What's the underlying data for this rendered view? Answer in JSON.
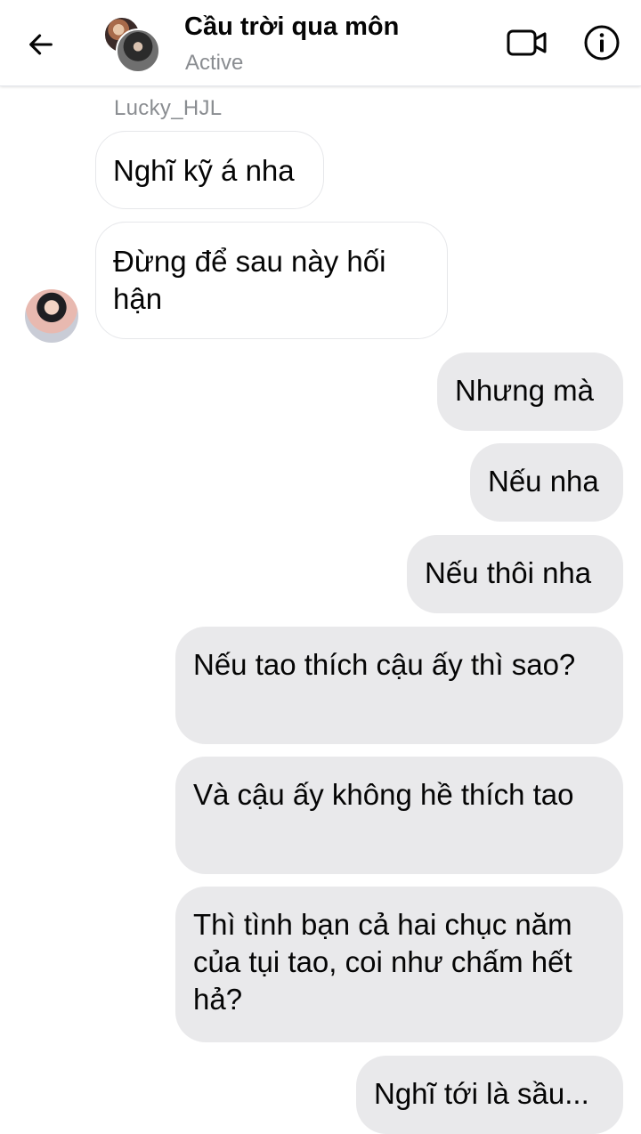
{
  "header": {
    "title": "Cầu trời qua môn",
    "status": "Active",
    "back_icon": "arrow-left-icon",
    "video_icon": "video-camera-icon",
    "info_icon": "info-icon"
  },
  "conversation": {
    "sender_name": "Lucky_HJL",
    "incoming": [
      {
        "text": "Nghĩ kỹ á nha"
      },
      {
        "text": "Đừng để sau này hối hận"
      }
    ],
    "outgoing": [
      {
        "text": "Nhưng mà"
      },
      {
        "text": "Nếu nha"
      },
      {
        "text": "Nếu thôi nha"
      },
      {
        "text": "Nếu tao thích cậu ấy thì sao?"
      },
      {
        "text": "Và cậu ấy không hề thích tao"
      },
      {
        "text": "Thì tình bạn cả hai chục năm của tụi tao, coi như chấm hết hả?"
      },
      {
        "text": "Nghĩ tới là sầu..."
      }
    ]
  },
  "colors": {
    "outgoing_bubble": "#e9e9eb",
    "incoming_bubble": "#ffffff",
    "muted_text": "#8a8d91"
  }
}
